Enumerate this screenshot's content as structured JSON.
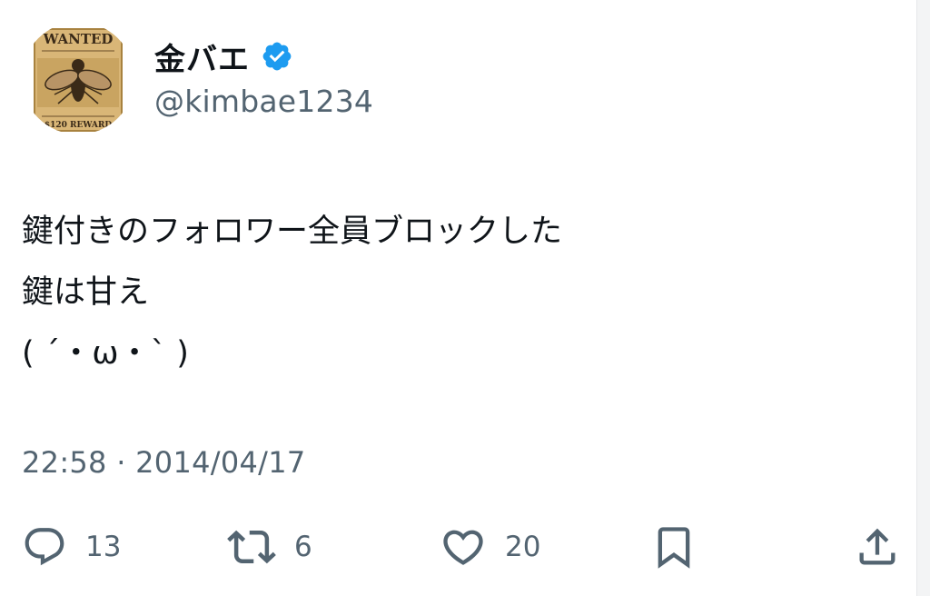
{
  "author": {
    "display_name": "金バエ",
    "handle": "@kimbae1234",
    "verified": true,
    "avatar": {
      "icon": "wanted-poster-fly-avatar",
      "poster_title": "WANTED",
      "poster_footer": "$120 REWARD"
    }
  },
  "tweet": {
    "lines": [
      "鍵付きのフォロワー全員ブロックした",
      "鍵は甘え",
      "( ´・ω・` )"
    ],
    "timestamp": "22:58 · 2014/04/17"
  },
  "actions": {
    "reply": {
      "icon": "reply-icon",
      "count": "13"
    },
    "retweet": {
      "icon": "retweet-icon",
      "count": "6"
    },
    "like": {
      "icon": "heart-icon",
      "count": "20"
    },
    "bookmark": {
      "icon": "bookmark-icon"
    },
    "share": {
      "icon": "share-icon"
    }
  },
  "colors": {
    "text_primary": "#0f1419",
    "text_secondary": "#536471",
    "verified_blue": "#1d9bf0"
  }
}
